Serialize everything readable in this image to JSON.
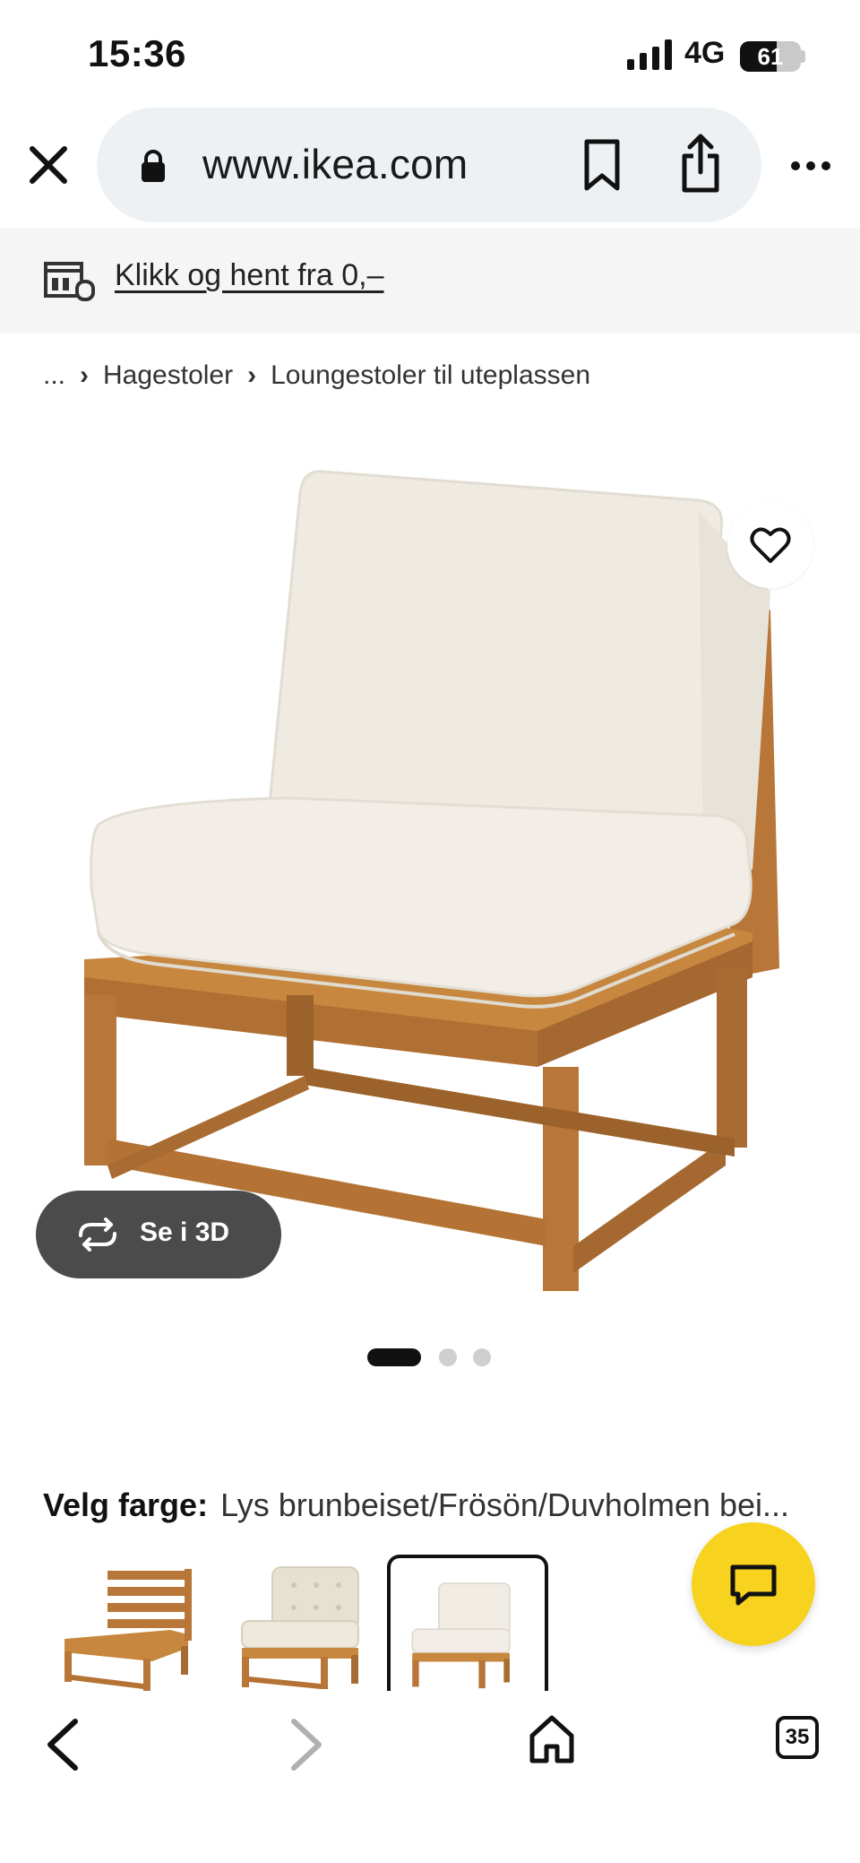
{
  "status_bar": {
    "time": "15:36",
    "network": "4G",
    "battery": "61",
    "battery_level": 0.61
  },
  "browser": {
    "url": "www.ikea.com",
    "icons": [
      "close-icon",
      "lock-icon",
      "bookmark-icon",
      "share-icon",
      "more-icon"
    ]
  },
  "promo": {
    "text": "Klikk og hent fra 0,–",
    "icon": "store-truck-icon"
  },
  "breadcrumb": {
    "items": [
      "...",
      "Hagestoler",
      "Loungestoler til uteplassen"
    ]
  },
  "gallery": {
    "see_3d_label": "Se i 3D",
    "active_index": 0,
    "count": 3
  },
  "color_selector": {
    "label": "Velg farge:",
    "value": "Lys brunbeiset/Frösön/Duvholmen bei...",
    "selected_index": 2,
    "options": [
      "no-cushion",
      "tufted-cushion",
      "plain-cushion"
    ]
  },
  "toolbar": {
    "tabs_count": "35"
  },
  "colors": {
    "promo_bg": "#f5f5f5",
    "url_pill_bg": "#eef1f4",
    "chat_fab": "#f7d21e",
    "see3d_bg": "#4b4b4b",
    "wood": "#b87638",
    "cushion": "#efebe3"
  }
}
